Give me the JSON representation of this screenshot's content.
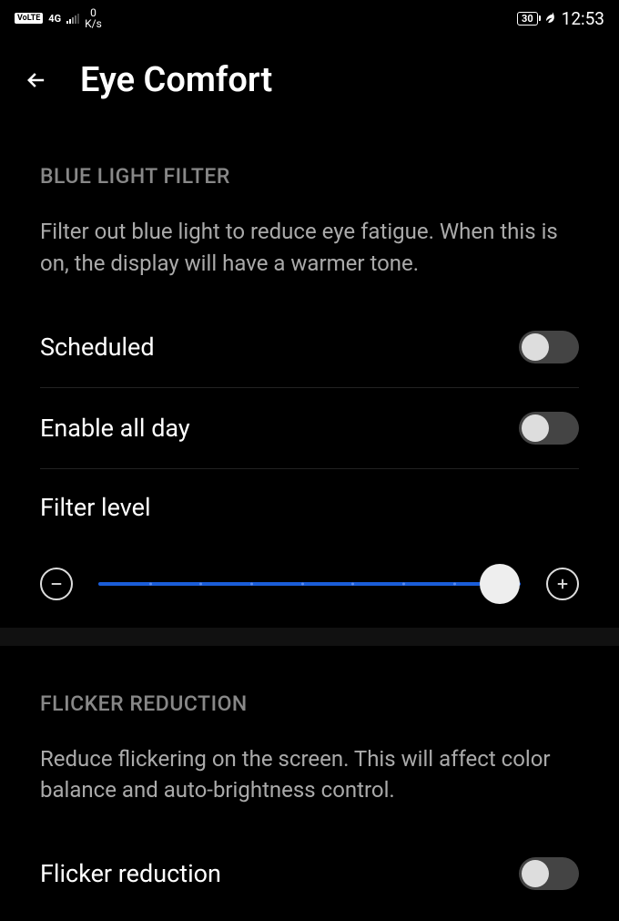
{
  "status_bar": {
    "volte": "VoLTE",
    "network": "4G",
    "speed_value": "0",
    "speed_unit": "K/s",
    "battery": "30",
    "clock": "12:53"
  },
  "header": {
    "title": "Eye Comfort"
  },
  "sections": {
    "blue_light": {
      "header": "BLUE LIGHT FILTER",
      "description": "Filter out blue light to reduce eye fatigue. When this is on, the display will have a warmer tone.",
      "scheduled_label": "Scheduled",
      "enable_all_day_label": "Enable all day",
      "filter_level_label": "Filter level"
    },
    "flicker": {
      "header": "FLICKER REDUCTION",
      "description": "Reduce flickering on the screen. This will affect color balance and auto-brightness control.",
      "flicker_reduction_label": "Flicker reduction"
    }
  },
  "slider": {
    "value_percent": 95
  }
}
